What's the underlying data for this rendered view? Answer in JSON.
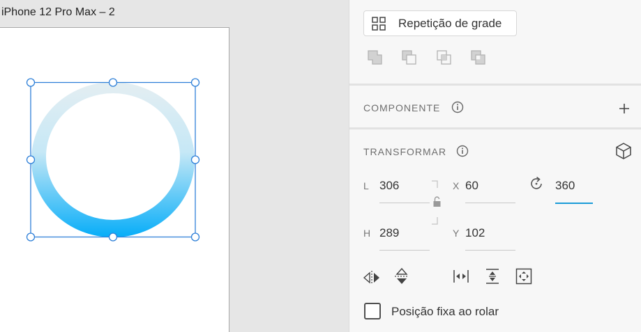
{
  "canvas": {
    "artboard_title": "iPhone 12 Pro Max – 2",
    "selected_shape": {
      "type": "ellipse-ring",
      "gradient_top_color": "#e4eef2",
      "gradient_bottom_color": "#06adf8",
      "selection_color": "#2f80d8"
    }
  },
  "panel": {
    "repeat_grid_label": "Repetição de grade",
    "boolean_ops": [
      "add-icon",
      "subtract-icon",
      "intersect-icon",
      "exclude-icon"
    ],
    "component": {
      "title": "COMPONENTE",
      "info_icon": "info-icon",
      "add_icon": "plus-icon"
    },
    "transform": {
      "title": "TRANSFORMAR",
      "info_icon": "info-icon",
      "cube_icon": "cube-icon",
      "width_letter": "L",
      "width_value": "306",
      "height_letter": "H",
      "height_value": "289",
      "x_letter": "X",
      "x_value": "60",
      "y_letter": "Y",
      "y_value": "102",
      "rotation_value": "360",
      "lock_icon": "unlock-icon",
      "rotation_icon": "rotate-icon",
      "accent_color": "#1a9bd7",
      "tools": [
        "flip-horizontal-icon",
        "flip-vertical-icon",
        "distribute-horizontal-icon",
        "distribute-vertical-icon",
        "fit-content-icon"
      ]
    },
    "fixed_position_label": "Posição fixa ao rolar",
    "fixed_position_checked": false
  }
}
